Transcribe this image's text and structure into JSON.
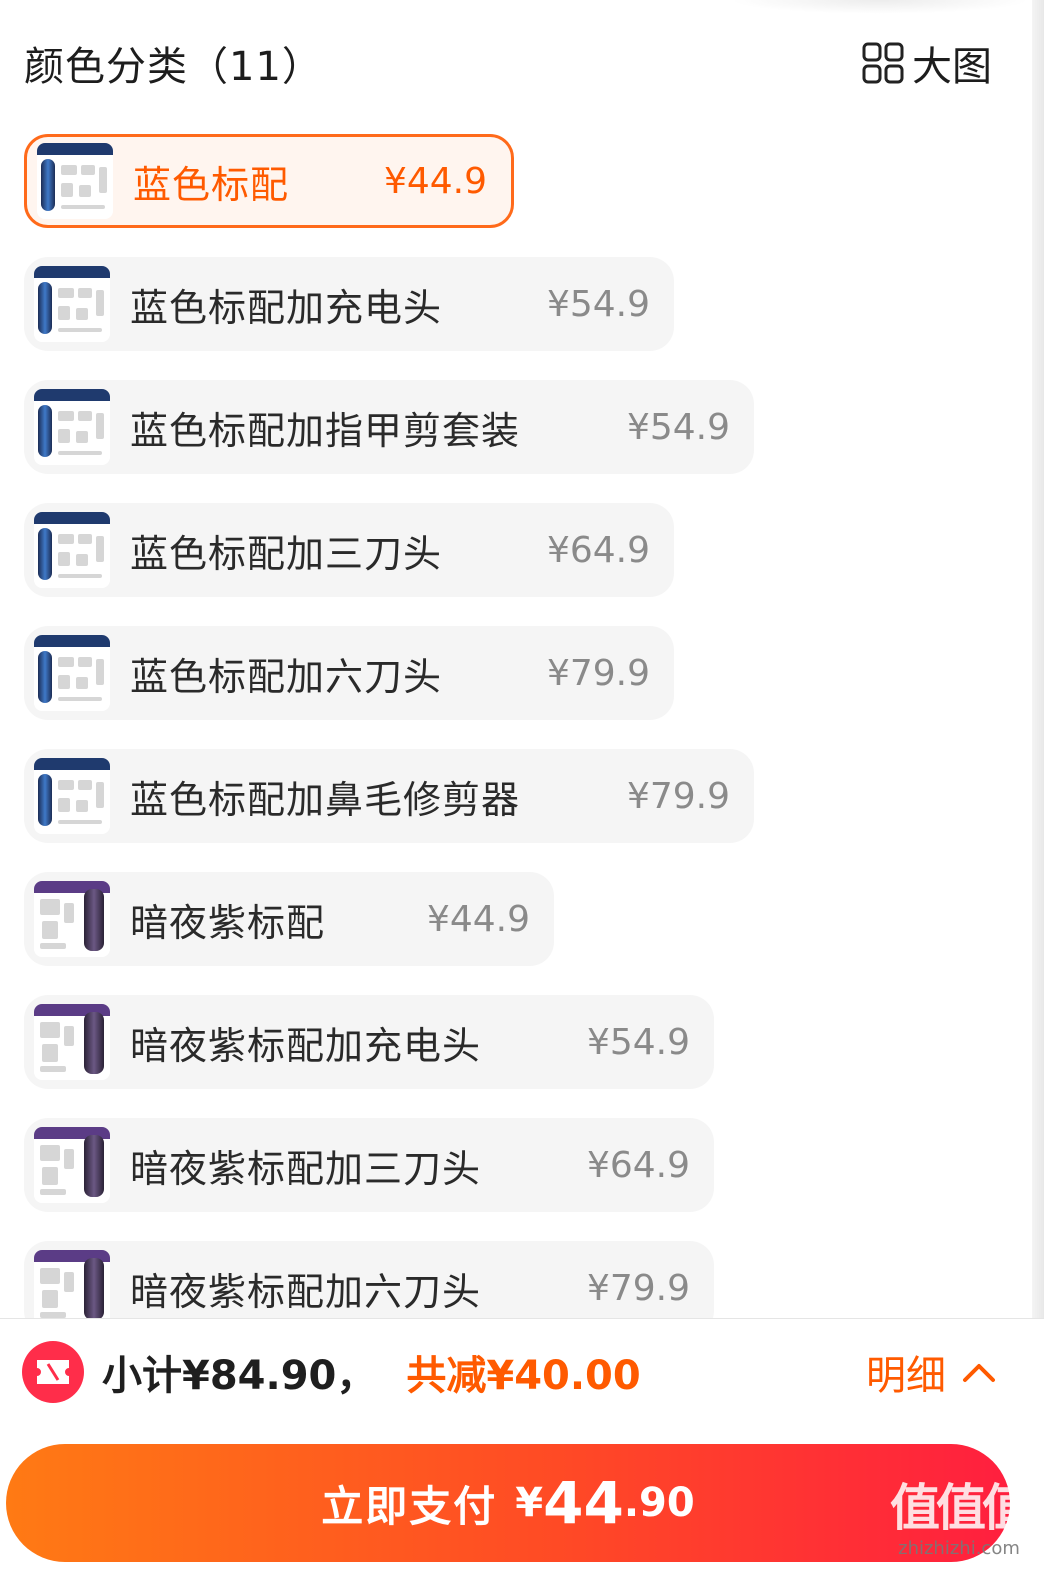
{
  "header": {
    "title": "颜色分类（11）",
    "big_view_label": "大图"
  },
  "variants": [
    {
      "label": "蓝色标配",
      "price": "¥44.9",
      "selected": true,
      "theme": "blue"
    },
    {
      "label": "蓝色标配加充电头",
      "price": "¥54.9",
      "selected": false,
      "theme": "blue"
    },
    {
      "label": "蓝色标配加指甲剪套装",
      "price": "¥54.9",
      "selected": false,
      "theme": "blue"
    },
    {
      "label": "蓝色标配加三刀头",
      "price": "¥64.9",
      "selected": false,
      "theme": "blue"
    },
    {
      "label": "蓝色标配加六刀头",
      "price": "¥79.9",
      "selected": false,
      "theme": "blue"
    },
    {
      "label": "蓝色标配加鼻毛修剪器",
      "price": "¥79.9",
      "selected": false,
      "theme": "blue"
    },
    {
      "label": "暗夜紫标配",
      "price": "¥44.9",
      "selected": false,
      "theme": "purple"
    },
    {
      "label": "暗夜紫标配加充电头",
      "price": "¥54.9",
      "selected": false,
      "theme": "purple"
    },
    {
      "label": "暗夜紫标配加三刀头",
      "price": "¥64.9",
      "selected": false,
      "theme": "purple"
    },
    {
      "label": "暗夜紫标配加六刀头",
      "price": "¥79.9",
      "selected": false,
      "theme": "purple"
    }
  ],
  "summary": {
    "subtotal": "小计¥84.90，",
    "discount": "共减¥40.00",
    "detail_label": "明细"
  },
  "pay": {
    "label": "立即支付",
    "currency": "¥",
    "amount_int": "44",
    "amount_dec": ".90"
  },
  "watermark": {
    "mark": "值值值",
    "url": "zhizhizhi.com"
  },
  "colors": {
    "accent": "#ff5a00",
    "blue_theme": "#1f3a6e",
    "purple_theme": "#5b3c86",
    "coupon": "#ff2d4a"
  },
  "icons": {
    "big_view": "grid-icon",
    "coupon": "ticket-icon",
    "detail": "chevron-up-icon"
  }
}
